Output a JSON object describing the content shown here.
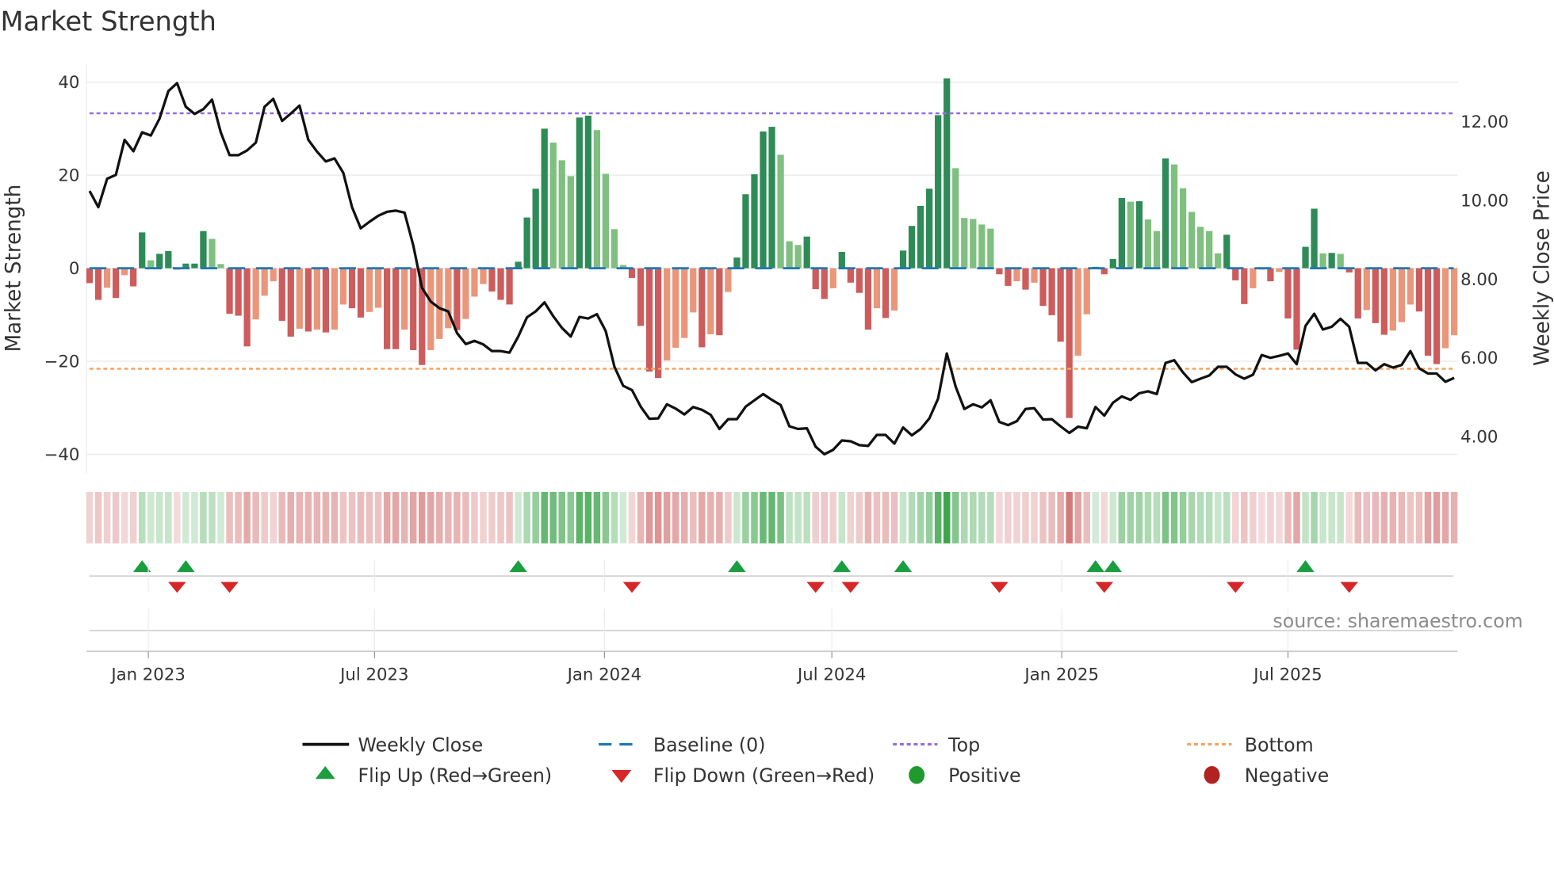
{
  "title": "Market Strength",
  "source": "source: sharemaestro.com",
  "chart_data": {
    "type": "bar+line",
    "title": "Market Strength",
    "ylabel": "Market Strength",
    "y2label": "Weekly Close Price",
    "ylim": [
      -44,
      44
    ],
    "y2lim": [
      3.2,
      13.6
    ],
    "yticks": [
      "40",
      "20",
      "0",
      "−20",
      "−40"
    ],
    "yticks_values": [
      40,
      20,
      0,
      -20,
      -40
    ],
    "y2ticks": [
      "12.00",
      "10.00",
      "8.00",
      "6.00",
      "4.00"
    ],
    "y2ticks_values": [
      12,
      10,
      8,
      6,
      4
    ],
    "xticks": [
      {
        "label": "Jan 2023",
        "date": "2023-01-01"
      },
      {
        "label": "Jul 2023",
        "date": "2023-07-01"
      },
      {
        "label": "Jan 2024",
        "date": "2024-01-01"
      },
      {
        "label": "Jul 2024",
        "date": "2024-07-01"
      },
      {
        "label": "Jan 2025",
        "date": "2025-01-01"
      },
      {
        "label": "Jul 2025",
        "date": "2025-07-01"
      }
    ],
    "x_start": "2022-11-15",
    "x_interval_days": 7,
    "top_level": 33.3,
    "bottom_level": -21.6,
    "baseline": 0,
    "strength": [
      -3.2,
      -6.8,
      -4.2,
      -6.4,
      -1.5,
      -3.9,
      7.7,
      1.7,
      3.1,
      3.7,
      -0.3,
      1.0,
      1.0,
      8.0,
      6.3,
      0.9,
      -9.8,
      -10.2,
      -16.8,
      -11.0,
      -5.9,
      -2.8,
      -11.3,
      -14.7,
      -13.0,
      -13.6,
      -13.2,
      -13.8,
      -13.2,
      -7.8,
      -8.6,
      -10.6,
      -9.4,
      -8.5,
      -17.4,
      -17.4,
      -13.2,
      -17.6,
      -20.8,
      -17.6,
      -15.2,
      -12.9,
      -13.3,
      -10.9,
      -6.1,
      -3.4,
      -5.0,
      -6.8,
      -7.8,
      1.4,
      10.9,
      17.1,
      30.0,
      27.0,
      23.2,
      19.8,
      32.4,
      32.8,
      29.7,
      20.3,
      8.4,
      0.7,
      -2.1,
      -12.4,
      -22.2,
      -23.6,
      -19.8,
      -17.1,
      -15.0,
      -9.5,
      -17.0,
      -14.2,
      -14.4,
      -5.1,
      2.3,
      15.9,
      20.2,
      29.4,
      30.4,
      24.4,
      5.8,
      5.0,
      6.8,
      -4.5,
      -6.6,
      -4.3,
      3.5,
      -3.1,
      -5.3,
      -13.2,
      -8.6,
      -10.7,
      -9.1,
      3.8,
      9.1,
      13.4,
      17.1,
      32.9,
      40.8,
      21.5,
      10.8,
      10.6,
      9.4,
      8.5,
      -1.3,
      -3.8,
      -2.8,
      -4.6,
      -3.1,
      -8.1,
      -10.1,
      -15.8,
      -32.2,
      -18.8,
      -9.9,
      0.3,
      -1.3,
      2.0,
      15.1,
      14.3,
      14.4,
      10.5,
      8.0,
      23.6,
      22.3,
      17.2,
      12.1,
      8.9,
      8.0,
      3.2,
      7.2,
      -2.6,
      -7.7,
      -4.3,
      -0.3,
      -2.8,
      -0.8,
      -10.8,
      -17.5,
      4.6,
      12.8,
      3.2,
      3.3,
      3.1,
      -0.9,
      -10.8,
      -9.0,
      -11.8,
      -14.3,
      -13.4,
      -11.6,
      -7.8,
      -9.3,
      -18.8,
      -20.6,
      -17.2,
      -14.4
    ],
    "weekly_close": [
      10.24,
      9.83,
      10.55,
      10.65,
      11.54,
      11.25,
      11.73,
      11.65,
      12.08,
      12.78,
      12.98,
      12.38,
      12.2,
      12.32,
      12.56,
      11.73,
      11.15,
      11.15,
      11.27,
      11.47,
      12.38,
      12.58,
      12.02,
      12.21,
      12.41,
      11.54,
      11.24,
      10.99,
      11.07,
      10.7,
      9.83,
      9.29,
      9.46,
      9.61,
      9.71,
      9.74,
      9.69,
      8.86,
      7.78,
      7.43,
      7.26,
      7.18,
      6.63,
      6.35,
      6.43,
      6.34,
      6.17,
      6.17,
      6.13,
      6.54,
      7.03,
      7.18,
      7.41,
      7.06,
      6.76,
      6.54,
      7.04,
      7.0,
      7.11,
      6.68,
      5.77,
      5.29,
      5.18,
      4.76,
      4.45,
      4.46,
      4.82,
      4.71,
      4.56,
      4.75,
      4.68,
      4.55,
      4.19,
      4.44,
      4.44,
      4.76,
      4.92,
      5.08,
      4.93,
      4.8,
      4.26,
      4.19,
      4.21,
      3.74,
      3.55,
      3.66,
      3.9,
      3.88,
      3.78,
      3.76,
      4.04,
      4.04,
      3.82,
      4.23,
      4.03,
      4.19,
      4.46,
      4.96,
      6.11,
      5.27,
      4.7,
      4.82,
      4.74,
      4.92,
      4.37,
      4.29,
      4.39,
      4.7,
      4.72,
      4.43,
      4.44,
      4.26,
      4.09,
      4.25,
      4.21,
      4.75,
      4.53,
      4.86,
      5.02,
      4.93,
      5.1,
      5.15,
      5.08,
      5.87,
      5.94,
      5.63,
      5.38,
      5.47,
      5.55,
      5.77,
      5.77,
      5.58,
      5.47,
      5.57,
      6.07,
      6.0,
      6.05,
      6.11,
      5.84,
      6.81,
      7.12,
      6.72,
      6.79,
      6.99,
      6.79,
      5.87,
      5.87,
      5.68,
      5.84,
      5.75,
      5.82,
      6.17,
      5.73,
      5.6,
      5.6,
      5.39,
      5.49
    ],
    "legend": {
      "placement": "bottom",
      "weekly_close": "Weekly Close",
      "baseline": "Baseline (0)",
      "top": "Top",
      "bottom": "Bottom",
      "flip_up": "Flip Up (Red→Green)",
      "flip_down": "Flip Down (Green→Red)",
      "positive": "Positive",
      "negative": "Negative"
    },
    "colors": {
      "pos_rising": "#2e8b57",
      "pos_falling": "#7fbf7f",
      "neg_falling": "#cd5c5c",
      "neg_rising": "#e9967a",
      "baseline": "#1f77b4",
      "top": "#9370db",
      "bottom": "#f4a460",
      "close": "#111111",
      "flip_up": "#1a9e3f",
      "flip_down": "#d62728",
      "positive": "#1e9a2e",
      "negative": "#b22222"
    }
  }
}
